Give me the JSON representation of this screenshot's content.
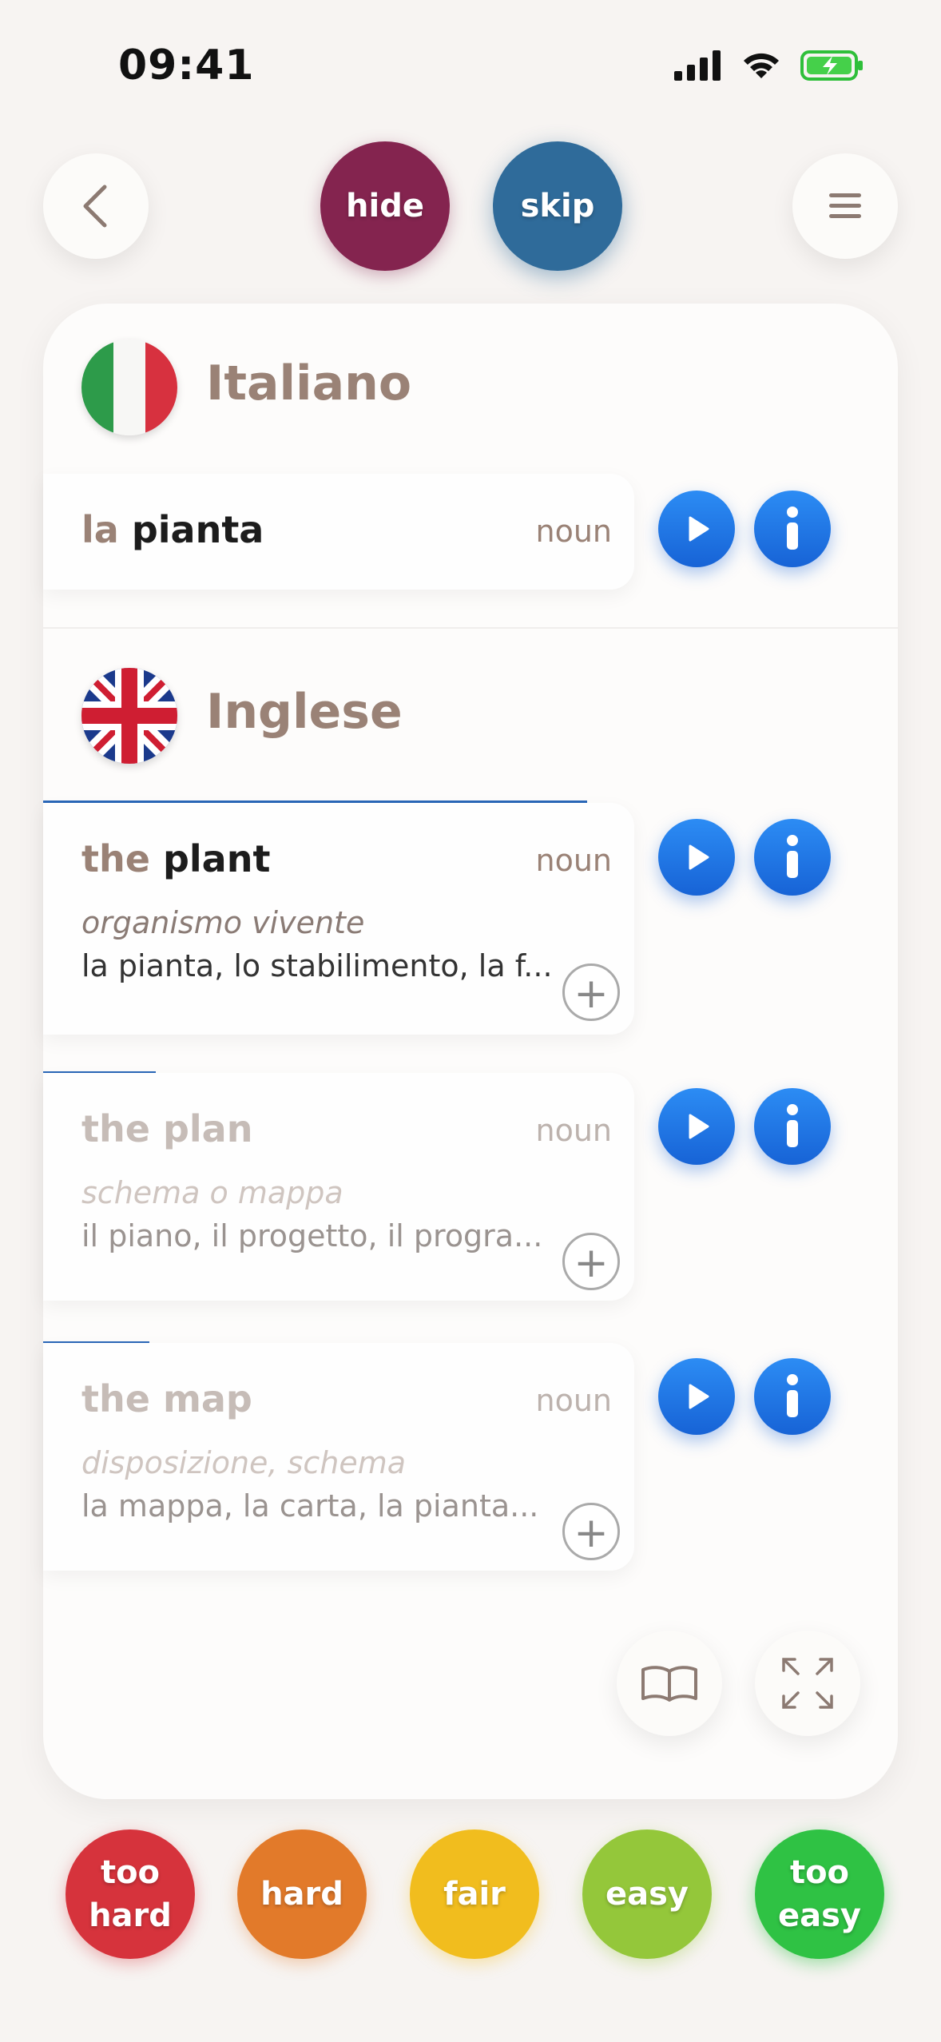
{
  "status_bar": {
    "time": "09:41"
  },
  "top_bar": {
    "hide_label": "hide",
    "skip_label": "skip"
  },
  "source": {
    "language": "Italiano",
    "article": "la",
    "word": "pianta",
    "pos": "noun"
  },
  "target": {
    "language": "Inglese",
    "entries": [
      {
        "article": "the",
        "word": "plant",
        "pos": "noun",
        "gloss": "organismo vivente",
        "translations": "la pianta, lo stabilimento, la f...",
        "progress": 0.92
      },
      {
        "article": "the",
        "word": "plan",
        "pos": "noun",
        "gloss": "schema o mappa",
        "translations": "il piano, il progetto, il progra...",
        "progress": 0.19
      },
      {
        "article": "the",
        "word": "map",
        "pos": "noun",
        "gloss": "disposizione, schema",
        "translations": "la mappa, la carta, la pianta...",
        "progress": 0.18
      }
    ]
  },
  "ratings": [
    {
      "line1": "too",
      "line2": "hard",
      "color": "#d6333c"
    },
    {
      "line1": "hard",
      "line2": "",
      "color": "#e27a2a"
    },
    {
      "line1": "fair",
      "line2": "",
      "color": "#f1bd1e"
    },
    {
      "line1": "easy",
      "line2": "",
      "color": "#94c73a"
    },
    {
      "line1": "too",
      "line2": "easy",
      "color": "#2fc244"
    }
  ],
  "icons": {
    "back": "chevron-left-icon",
    "menu": "hamburger-icon",
    "play": "play-icon",
    "info": "info-icon",
    "add": "plus-icon",
    "book": "book-icon",
    "expand": "expand-icon"
  },
  "colors": {
    "accent_blue": "#1f73e0",
    "hide": "#84244f",
    "skip": "#2f6b9a",
    "label_brown": "#9a8276"
  }
}
